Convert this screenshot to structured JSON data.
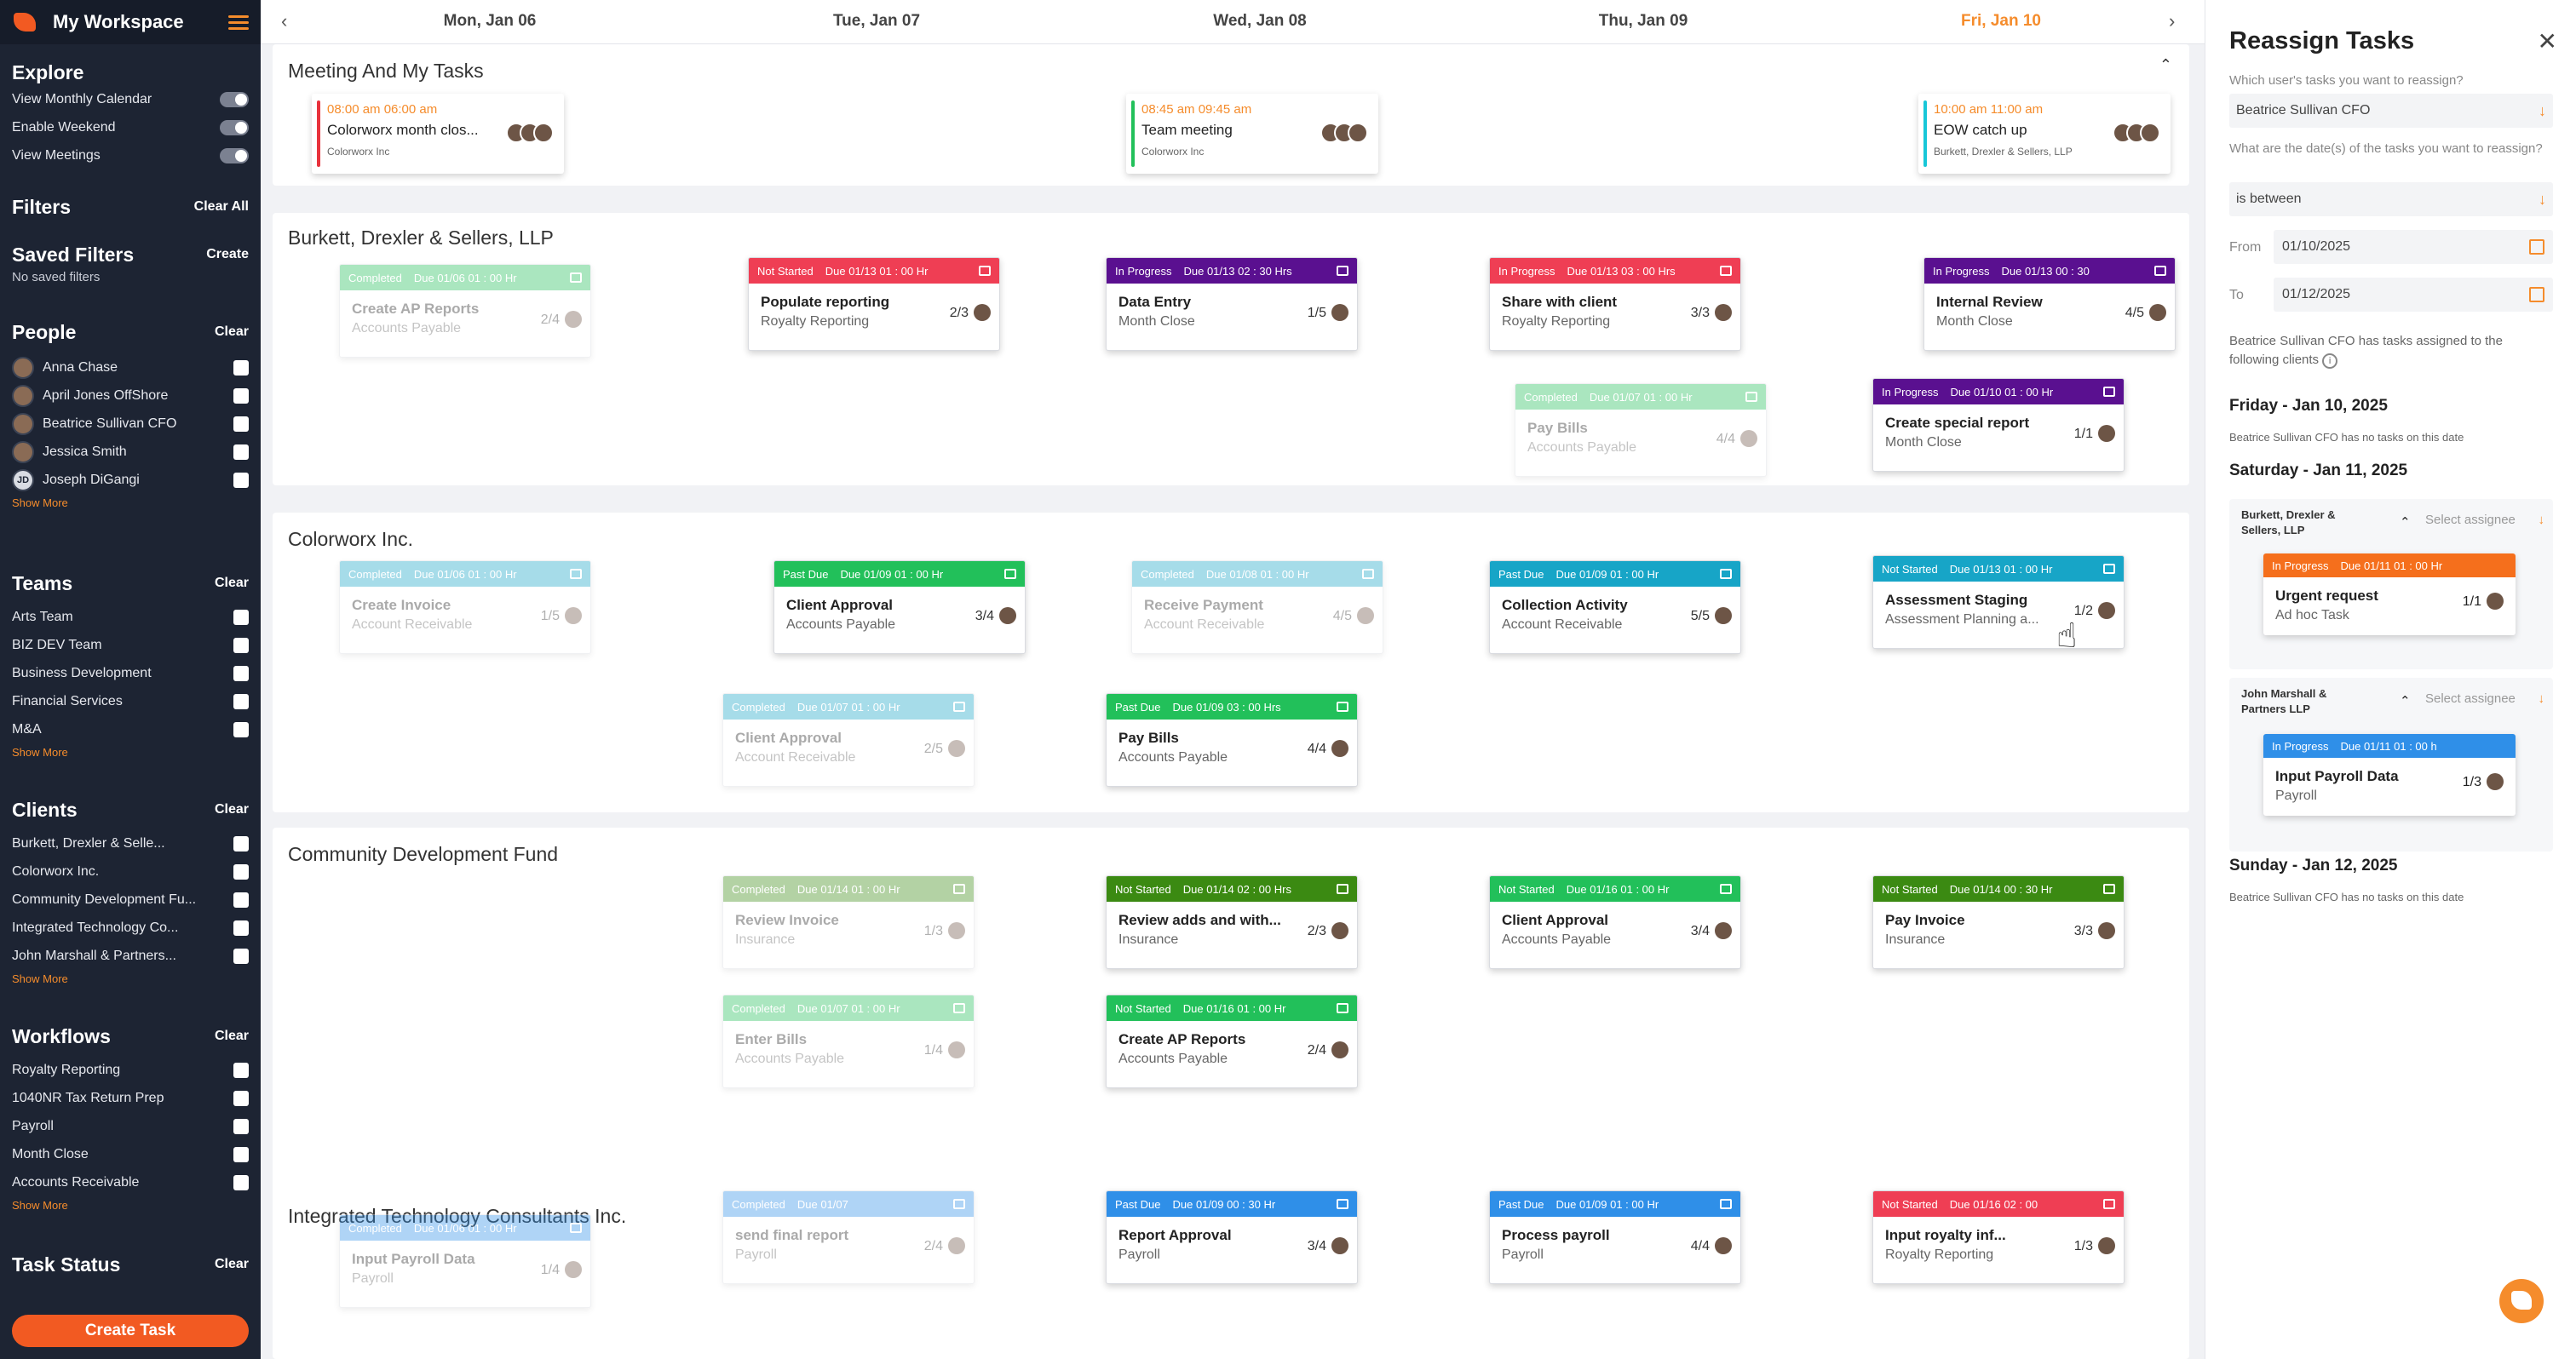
{
  "sidebar": {
    "title": "My Workspace",
    "explore": {
      "title": "Explore",
      "items": [
        "View Monthly Calendar",
        "Enable Weekend",
        "View Meetings"
      ]
    },
    "filters": {
      "title": "Filters",
      "action": "Clear All"
    },
    "saved_filters": {
      "title": "Saved Filters",
      "action": "Create",
      "note": "No saved filters"
    },
    "people": {
      "title": "People",
      "action": "Clear",
      "items": [
        {
          "name": "Anna Chase",
          "initials": ""
        },
        {
          "name": "April Jones OffShore",
          "initials": ""
        },
        {
          "name": "Beatrice Sullivan CFO",
          "initials": ""
        },
        {
          "name": "Jessica Smith",
          "initials": ""
        },
        {
          "name": "Joseph DiGangi",
          "initials": "JD"
        }
      ],
      "more": "Show More"
    },
    "teams": {
      "title": "Teams",
      "action": "Clear",
      "items": [
        "Arts Team",
        "BIZ DEV Team",
        "Business Development",
        "Financial Services",
        "M&A"
      ],
      "more": "Show More"
    },
    "clients": {
      "title": "Clients",
      "action": "Clear",
      "items": [
        "Burkett, Drexler & Selle...",
        "Colorworx Inc.",
        "Community Development Fu...",
        "Integrated Technology Co...",
        "John Marshall & Partners..."
      ],
      "more": "Show More"
    },
    "workflows": {
      "title": "Workflows",
      "action": "Clear",
      "items": [
        "Royalty Reporting",
        "1040NR Tax Return Prep",
        "Payroll",
        "Month Close",
        "Accounts Receivable"
      ],
      "more": "Show More"
    },
    "task_status": {
      "title": "Task Status",
      "action": "Clear"
    },
    "create_task": "Create Task"
  },
  "header": {
    "prev": "‹",
    "next": "›",
    "days": [
      "Mon, Jan 06",
      "Tue, Jan 07",
      "Wed, Jan 08",
      "Thu, Jan 09",
      "Fri, Jan 10"
    ]
  },
  "meetings": {
    "title": "Meeting And My Tasks",
    "collapse": "⌃",
    "items": [
      {
        "time": "08:00 am 06:00 am",
        "title": "Colorworx month clos...",
        "client": "Colorworx Inc",
        "line": "#e8323c",
        "time_color": "#f58c2c"
      },
      {
        "time": "08:45 am 09:45 am",
        "title": "Team meeting",
        "client": "Colorworx Inc",
        "line": "#22c05a",
        "time_color": "#f58c2c"
      },
      {
        "time": "10:00 am 11:00 am",
        "title": "EOW catch up",
        "client": "Burkett, Drexler & Sellers, LLP",
        "line": "#17c7d8",
        "time_color": "#f58c2c"
      }
    ]
  },
  "groups": [
    {
      "title": "Burkett, Drexler & Sellers, LLP"
    },
    {
      "title": "Colorworx Inc."
    },
    {
      "title": "Community Development Fund"
    },
    {
      "title": "Integrated Technology Consultants Inc."
    }
  ],
  "cards": [
    {
      "status": "Completed",
      "due": "Due 01/06 01 : 00 Hr",
      "title": "Create AP Reports",
      "sub": "Accounts Payable",
      "count": "2/4",
      "color": "#22c05a",
      "faded": true
    },
    {
      "status": "Not Started",
      "due": "Due 01/13 01 : 00 Hr",
      "title": "Populate reporting",
      "sub": "Royalty Reporting",
      "count": "2/3",
      "color": "#ef3e54",
      "faded": false
    },
    {
      "status": "In Progress",
      "due": "Due 01/13 02 : 30 Hrs",
      "title": "Data Entry",
      "sub": "Month Close",
      "count": "1/5",
      "color": "#5a1090",
      "faded": false
    },
    {
      "status": "In Progress",
      "due": "Due 01/13 03 : 00 Hrs",
      "title": "Share with client",
      "sub": "Royalty Reporting",
      "count": "3/3",
      "color": "#ef3e54",
      "faded": false
    },
    {
      "status": "Completed",
      "due": "Due 01/07 01 : 00 Hr",
      "title": "Pay Bills",
      "sub": "Accounts Payable",
      "count": "4/4",
      "color": "#22c05a",
      "faded": true
    },
    {
      "status": "In Progress",
      "due": "Due 01/13 00 : 30",
      "title": "Internal Review",
      "sub": "Month Close",
      "count": "4/5",
      "color": "#5a1090",
      "faded": false
    },
    {
      "status": "In Progress",
      "due": "Due 01/10 01 : 00 Hr",
      "title": "Create special report",
      "sub": "Month Close",
      "count": "1/1",
      "color": "#5a1090",
      "faded": false
    },
    {
      "status": "Completed",
      "due": "Due 01/06 01 : 00 Hr",
      "title": "Create Invoice",
      "sub": "Account Receivable",
      "count": "1/5",
      "color": "#17a5c7",
      "faded": true
    },
    {
      "status": "Past Due",
      "due": "Due 01/09 01 : 00 Hr",
      "title": "Client Approval",
      "sub": "Accounts Payable",
      "count": "3/4",
      "color": "#22c05a",
      "faded": false
    },
    {
      "status": "Completed",
      "due": "Due 01/08 01 : 00 Hr",
      "title": "Receive Payment",
      "sub": "Account Receivable",
      "count": "4/5",
      "color": "#17a5c7",
      "faded": true
    },
    {
      "status": "Past Due",
      "due": "Due 01/09 01 : 00 Hr",
      "title": "Collection Activity",
      "sub": "Account Receivable",
      "count": "5/5",
      "color": "#17a5c7",
      "faded": false
    },
    {
      "status": "Not Started",
      "due": "Due 01/13 01 : 00 Hr",
      "title": "Assessment Staging",
      "sub": "Assessment Planning a...",
      "count": "1/2",
      "color": "#17a5c7",
      "faded": false
    },
    {
      "status": "Completed",
      "due": "Due 01/07 01 : 00 Hr",
      "title": "Client Approval",
      "sub": "Account Receivable",
      "count": "2/5",
      "color": "#17a5c7",
      "faded": true
    },
    {
      "status": "Past Due",
      "due": "Due 01/09 03 : 00 Hrs",
      "title": "Pay Bills",
      "sub": "Accounts Payable",
      "count": "4/4",
      "color": "#22c05a",
      "faded": false
    },
    {
      "status": "Completed",
      "due": "Due 01/14 01 : 00 Hr",
      "title": "Review Invoice",
      "sub": "Insurance",
      "count": "1/3",
      "color": "#3b8a12",
      "faded": true
    },
    {
      "status": "Not Started",
      "due": "Due 01/14 02 : 00 Hrs",
      "title": "Review adds and with...",
      "sub": "Insurance",
      "count": "2/3",
      "color": "#3b8a12",
      "faded": false
    },
    {
      "status": "Not Started",
      "due": "Due 01/16 01 : 00 Hr",
      "title": "Client Approval",
      "sub": "Accounts Payable",
      "count": "3/4",
      "color": "#22c05a",
      "faded": false
    },
    {
      "status": "Not Started",
      "due": "Due 01/14 00 : 30 Hr",
      "title": "Pay Invoice",
      "sub": "Insurance",
      "count": "3/3",
      "color": "#3b8a12",
      "faded": false
    },
    {
      "status": "Completed",
      "due": "Due 01/07 01 : 00 Hr",
      "title": "Enter Bills",
      "sub": "Accounts Payable",
      "count": "1/4",
      "color": "#22c05a",
      "faded": true
    },
    {
      "status": "Not Started",
      "due": "Due 01/16 01 : 00 Hr",
      "title": "Create AP Reports",
      "sub": "Accounts Payable",
      "count": "2/4",
      "color": "#22c05a",
      "faded": false
    },
    {
      "status": "Completed",
      "due": "Due 01/06 01 : 00 Hr",
      "title": "Input Payroll Data",
      "sub": "Payroll",
      "count": "1/4",
      "color": "#2f8fe8",
      "faded": true
    },
    {
      "status": "Completed",
      "due": "Due 01/07",
      "title": "send final report",
      "sub": "Payroll",
      "count": "2/4",
      "color": "#2f8fe8",
      "faded": true
    },
    {
      "status": "Past Due",
      "due": "Due 01/09 00 : 30 Hr",
      "title": "Report Approval",
      "sub": "Payroll",
      "count": "3/4",
      "color": "#2f8fe8",
      "faded": false
    },
    {
      "status": "Past Due",
      "due": "Due 01/09 01 : 00 Hr",
      "title": "Process payroll",
      "sub": "Payroll",
      "count": "4/4",
      "color": "#2f8fe8",
      "faded": false
    },
    {
      "status": "Not Started",
      "due": "Due 01/16 02 : 00",
      "title": "Input royalty inf...",
      "sub": "Royalty Reporting",
      "count": "1/3",
      "color": "#ef3e54",
      "faded": false
    }
  ],
  "panel": {
    "title": "Reassign Tasks",
    "close": "✕",
    "q1": "Which user's tasks you want to reassign?",
    "user": "Beatrice Sullivan CFO",
    "q2": "What are the date(s) of the tasks you want to reassign?",
    "range": "is between",
    "from_label": "From",
    "from": "01/10/2025",
    "to_label": "To",
    "to": "01/12/2025",
    "info": "Beatrice Sullivan CFO has tasks assigned to the following clients",
    "fri": "Friday - Jan 10, 2025",
    "fri_note": "Beatrice Sullivan CFO has no tasks on this date",
    "sat": "Saturday - Jan 11, 2025",
    "select_placeholder": "Select assignee",
    "g1": {
      "name": "Burkett, Drexler & Sellers, LLP",
      "status": "In Progress",
      "due": "Due 01/11 01 : 00 Hr",
      "title": "Urgent request",
      "sub": "Ad hoc Task",
      "count": "1/1",
      "color": "#f56f1c"
    },
    "g2": {
      "name": "John Marshall & Partners LLP",
      "status": "In Progress",
      "due": "Due 01/11 01 : 00 h",
      "title": "Input Payroll Data",
      "sub": "Payroll",
      "count": "1/3",
      "color": "#2f8fe8"
    },
    "sun": "Sunday - Jan 12, 2025",
    "sun_note": "Beatrice Sullivan CFO has no tasks on this date"
  }
}
